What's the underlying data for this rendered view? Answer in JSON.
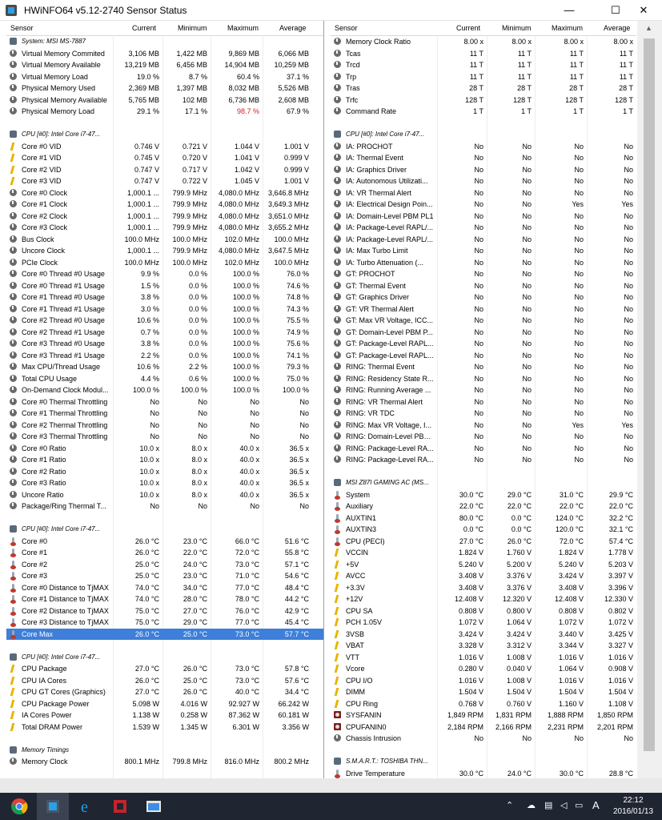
{
  "window": {
    "title": "HWiNFO64 v5.12-2740 Sensor Status",
    "minimize": "—",
    "maximize": "☐",
    "close": "✕"
  },
  "columns": {
    "sensor": "Sensor",
    "current": "Current",
    "minimum": "Minimum",
    "maximum": "Maximum",
    "average": "Average"
  },
  "left_rows": [
    {
      "type": "group",
      "name": "System: MSI MS-7887"
    },
    {
      "icon": "load",
      "name": "Virtual Memory Commited",
      "cur": "3,106 MB",
      "min": "1,422 MB",
      "max": "9,869 MB",
      "avg": "6,066 MB"
    },
    {
      "icon": "load",
      "name": "Virtual Memory Available",
      "cur": "13,219 MB",
      "min": "6,456 MB",
      "max": "14,904 MB",
      "avg": "10,259 MB"
    },
    {
      "icon": "load",
      "name": "Virtual Memory Load",
      "cur": "19.0 %",
      "min": "8.7 %",
      "max": "60.4 %",
      "avg": "37.1 %"
    },
    {
      "icon": "load",
      "name": "Physical Memory Used",
      "cur": "2,369 MB",
      "min": "1,397 MB",
      "max": "8,032 MB",
      "avg": "5,526 MB"
    },
    {
      "icon": "load",
      "name": "Physical Memory Available",
      "cur": "5,765 MB",
      "min": "102 MB",
      "max": "6,736 MB",
      "avg": "2,608 MB"
    },
    {
      "icon": "load",
      "name": "Physical Memory Load",
      "cur": "29.1 %",
      "min": "17.1 %",
      "max": "98.7 %",
      "avg": "67.9 %",
      "max_red": true
    },
    {
      "type": "spacer"
    },
    {
      "type": "group",
      "name": "CPU [#0]: Intel Core i7-47..."
    },
    {
      "icon": "volt",
      "name": "Core #0 VID",
      "cur": "0.746 V",
      "min": "0.721 V",
      "max": "1.044 V",
      "avg": "1.001 V"
    },
    {
      "icon": "volt",
      "name": "Core #1 VID",
      "cur": "0.745 V",
      "min": "0.720 V",
      "max": "1.041 V",
      "avg": "0.999 V"
    },
    {
      "icon": "volt",
      "name": "Core #2 VID",
      "cur": "0.747 V",
      "min": "0.717 V",
      "max": "1.042 V",
      "avg": "0.999 V"
    },
    {
      "icon": "volt",
      "name": "Core #3 VID",
      "cur": "0.747 V",
      "min": "0.722 V",
      "max": "1.045 V",
      "avg": "1.001 V"
    },
    {
      "icon": "load",
      "name": "Core #0 Clock",
      "cur": "1,000.1 ...",
      "min": "799.9 MHz",
      "max": "4,080.0 MHz",
      "avg": "3,646.8 MHz"
    },
    {
      "icon": "load",
      "name": "Core #1 Clock",
      "cur": "1,000.1 ...",
      "min": "799.9 MHz",
      "max": "4,080.0 MHz",
      "avg": "3,649.3 MHz"
    },
    {
      "icon": "load",
      "name": "Core #2 Clock",
      "cur": "1,000.1 ...",
      "min": "799.9 MHz",
      "max": "4,080.0 MHz",
      "avg": "3,651.0 MHz"
    },
    {
      "icon": "load",
      "name": "Core #3 Clock",
      "cur": "1,000.1 ...",
      "min": "799.9 MHz",
      "max": "4,080.0 MHz",
      "avg": "3,655.2 MHz"
    },
    {
      "icon": "load",
      "name": "Bus Clock",
      "cur": "100.0 MHz",
      "min": "100.0 MHz",
      "max": "102.0 MHz",
      "avg": "100.0 MHz"
    },
    {
      "icon": "load",
      "name": "Uncore Clock",
      "cur": "1,000.1 ...",
      "min": "799.9 MHz",
      "max": "4,080.0 MHz",
      "avg": "3,647.5 MHz"
    },
    {
      "icon": "load",
      "name": "PCIe Clock",
      "cur": "100.0 MHz",
      "min": "100.0 MHz",
      "max": "102.0 MHz",
      "avg": "100.0 MHz"
    },
    {
      "icon": "load",
      "name": "Core #0 Thread #0 Usage",
      "cur": "9.9 %",
      "min": "0.0 %",
      "max": "100.0 %",
      "avg": "76.0 %"
    },
    {
      "icon": "load",
      "name": "Core #0 Thread #1 Usage",
      "cur": "1.5 %",
      "min": "0.0 %",
      "max": "100.0 %",
      "avg": "74.6 %"
    },
    {
      "icon": "load",
      "name": "Core #1 Thread #0 Usage",
      "cur": "3.8 %",
      "min": "0.0 %",
      "max": "100.0 %",
      "avg": "74.8 %"
    },
    {
      "icon": "load",
      "name": "Core #1 Thread #1 Usage",
      "cur": "3.0 %",
      "min": "0.0 %",
      "max": "100.0 %",
      "avg": "74.3 %"
    },
    {
      "icon": "load",
      "name": "Core #2 Thread #0 Usage",
      "cur": "10.6 %",
      "min": "0.0 %",
      "max": "100.0 %",
      "avg": "75.5 %"
    },
    {
      "icon": "load",
      "name": "Core #2 Thread #1 Usage",
      "cur": "0.7 %",
      "min": "0.0 %",
      "max": "100.0 %",
      "avg": "74.9 %"
    },
    {
      "icon": "load",
      "name": "Core #3 Thread #0 Usage",
      "cur": "3.8 %",
      "min": "0.0 %",
      "max": "100.0 %",
      "avg": "75.6 %"
    },
    {
      "icon": "load",
      "name": "Core #3 Thread #1 Usage",
      "cur": "2.2 %",
      "min": "0.0 %",
      "max": "100.0 %",
      "avg": "74.1 %"
    },
    {
      "icon": "load",
      "name": "Max CPU/Thread Usage",
      "cur": "10.6 %",
      "min": "2.2 %",
      "max": "100.0 %",
      "avg": "79.3 %"
    },
    {
      "icon": "load",
      "name": "Total CPU Usage",
      "cur": "4.4 %",
      "min": "0.6 %",
      "max": "100.0 %",
      "avg": "75.0 %"
    },
    {
      "icon": "load",
      "name": "On-Demand Clock Modul...",
      "cur": "100.0 %",
      "min": "100.0 %",
      "max": "100.0 %",
      "avg": "100.0 %"
    },
    {
      "icon": "load",
      "name": "Core #0 Thermal Throttling",
      "cur": "No",
      "min": "No",
      "max": "No",
      "avg": "No"
    },
    {
      "icon": "load",
      "name": "Core #1 Thermal Throttling",
      "cur": "No",
      "min": "No",
      "max": "No",
      "avg": "No"
    },
    {
      "icon": "load",
      "name": "Core #2 Thermal Throttling",
      "cur": "No",
      "min": "No",
      "max": "No",
      "avg": "No"
    },
    {
      "icon": "load",
      "name": "Core #3 Thermal Throttling",
      "cur": "No",
      "min": "No",
      "max": "No",
      "avg": "No"
    },
    {
      "icon": "load",
      "name": "Core #0 Ratio",
      "cur": "10.0 x",
      "min": "8.0 x",
      "max": "40.0 x",
      "avg": "36.5 x"
    },
    {
      "icon": "load",
      "name": "Core #1 Ratio",
      "cur": "10.0 x",
      "min": "8.0 x",
      "max": "40.0 x",
      "avg": "36.5 x"
    },
    {
      "icon": "load",
      "name": "Core #2 Ratio",
      "cur": "10.0 x",
      "min": "8.0 x",
      "max": "40.0 x",
      "avg": "36.5 x"
    },
    {
      "icon": "load",
      "name": "Core #3 Ratio",
      "cur": "10.0 x",
      "min": "8.0 x",
      "max": "40.0 x",
      "avg": "36.5 x"
    },
    {
      "icon": "load",
      "name": "Uncore Ratio",
      "cur": "10.0 x",
      "min": "8.0 x",
      "max": "40.0 x",
      "avg": "36.5 x"
    },
    {
      "icon": "load",
      "name": "Package/Ring Thermal T...",
      "cur": "No",
      "min": "No",
      "max": "No",
      "avg": "No"
    },
    {
      "type": "spacer"
    },
    {
      "type": "group",
      "name": "CPU [#0]: Intel Core i7-47..."
    },
    {
      "icon": "temp",
      "name": "Core #0",
      "cur": "26.0 °C",
      "min": "23.0 °C",
      "max": "66.0 °C",
      "avg": "51.6 °C"
    },
    {
      "icon": "temp",
      "name": "Core #1",
      "cur": "26.0 °C",
      "min": "22.0 °C",
      "max": "72.0 °C",
      "avg": "55.8 °C"
    },
    {
      "icon": "temp",
      "name": "Core #2",
      "cur": "25.0 °C",
      "min": "24.0 °C",
      "max": "73.0 °C",
      "avg": "57.1 °C"
    },
    {
      "icon": "temp",
      "name": "Core #3",
      "cur": "25.0 °C",
      "min": "23.0 °C",
      "max": "71.0 °C",
      "avg": "54.6 °C"
    },
    {
      "icon": "temp",
      "name": "Core #0 Distance to TjMAX",
      "cur": "74.0 °C",
      "min": "34.0 °C",
      "max": "77.0 °C",
      "avg": "48.4 °C"
    },
    {
      "icon": "temp",
      "name": "Core #1 Distance to TjMAX",
      "cur": "74.0 °C",
      "min": "28.0 °C",
      "max": "78.0 °C",
      "avg": "44.2 °C"
    },
    {
      "icon": "temp",
      "name": "Core #2 Distance to TjMAX",
      "cur": "75.0 °C",
      "min": "27.0 °C",
      "max": "76.0 °C",
      "avg": "42.9 °C"
    },
    {
      "icon": "temp",
      "name": "Core #3 Distance to TjMAX",
      "cur": "75.0 °C",
      "min": "29.0 °C",
      "max": "77.0 °C",
      "avg": "45.4 °C"
    },
    {
      "icon": "temp",
      "name": "Core Max",
      "cur": "26.0 °C",
      "min": "25.0 °C",
      "max": "73.0 °C",
      "avg": "57.7 °C",
      "selected": true
    },
    {
      "type": "spacer"
    },
    {
      "type": "group",
      "name": "CPU [#0]: Intel Core i7-47..."
    },
    {
      "icon": "volt",
      "name": "CPU Package",
      "cur": "27.0 °C",
      "min": "26.0 °C",
      "max": "73.0 °C",
      "avg": "57.8 °C"
    },
    {
      "icon": "volt",
      "name": "CPU IA Cores",
      "cur": "26.0 °C",
      "min": "25.0 °C",
      "max": "73.0 °C",
      "avg": "57.6 °C"
    },
    {
      "icon": "volt",
      "name": "CPU GT Cores (Graphics)",
      "cur": "27.0 °C",
      "min": "26.0 °C",
      "max": "40.0 °C",
      "avg": "34.4 °C"
    },
    {
      "icon": "volt",
      "name": "CPU Package Power",
      "cur": "5.098 W",
      "min": "4.016 W",
      "max": "92.927 W",
      "avg": "66.242 W"
    },
    {
      "icon": "volt",
      "name": "IA Cores Power",
      "cur": "1.138 W",
      "min": "0.258 W",
      "max": "87.362 W",
      "avg": "60.181 W"
    },
    {
      "icon": "volt",
      "name": "Total DRAM Power",
      "cur": "1.539 W",
      "min": "1.345 W",
      "max": "6.301 W",
      "avg": "3.356 W"
    },
    {
      "type": "spacer"
    },
    {
      "type": "group",
      "name": "Memory Timings"
    },
    {
      "icon": "load",
      "name": "Memory Clock",
      "cur": "800.1 MHz",
      "min": "799.8 MHz",
      "max": "816.0 MHz",
      "avg": "800.2 MHz"
    }
  ],
  "right_rows": [
    {
      "icon": "load",
      "name": "Memory Clock Ratio",
      "cur": "8.00 x",
      "min": "8.00 x",
      "max": "8.00 x",
      "avg": "8.00 x"
    },
    {
      "icon": "load",
      "name": "Tcas",
      "cur": "11 T",
      "min": "11 T",
      "max": "11 T",
      "avg": "11 T"
    },
    {
      "icon": "load",
      "name": "Trcd",
      "cur": "11 T",
      "min": "11 T",
      "max": "11 T",
      "avg": "11 T"
    },
    {
      "icon": "load",
      "name": "Trp",
      "cur": "11 T",
      "min": "11 T",
      "max": "11 T",
      "avg": "11 T"
    },
    {
      "icon": "load",
      "name": "Tras",
      "cur": "28 T",
      "min": "28 T",
      "max": "28 T",
      "avg": "28 T"
    },
    {
      "icon": "load",
      "name": "Trfc",
      "cur": "128 T",
      "min": "128 T",
      "max": "128 T",
      "avg": "128 T"
    },
    {
      "icon": "load",
      "name": "Command Rate",
      "cur": "1 T",
      "min": "1 T",
      "max": "1 T",
      "avg": "1 T"
    },
    {
      "type": "spacer"
    },
    {
      "type": "group",
      "name": "CPU [#0]: Intel Core i7-47..."
    },
    {
      "icon": "load",
      "name": "IA: PROCHOT",
      "cur": "No",
      "min": "No",
      "max": "No",
      "avg": "No"
    },
    {
      "icon": "load",
      "name": "IA: Thermal Event",
      "cur": "No",
      "min": "No",
      "max": "No",
      "avg": "No"
    },
    {
      "icon": "load",
      "name": "IA: Graphics Driver",
      "cur": "No",
      "min": "No",
      "max": "No",
      "avg": "No"
    },
    {
      "icon": "load",
      "name": "IA: Autonomous Utilizati...",
      "cur": "No",
      "min": "No",
      "max": "No",
      "avg": "No"
    },
    {
      "icon": "load",
      "name": "IA: VR Thermal Alert",
      "cur": "No",
      "min": "No",
      "max": "No",
      "avg": "No"
    },
    {
      "icon": "load",
      "name": "IA: Electrical Design Poin...",
      "cur": "No",
      "min": "No",
      "max": "Yes",
      "avg": "Yes"
    },
    {
      "icon": "load",
      "name": "IA: Domain-Level PBM PL1",
      "cur": "No",
      "min": "No",
      "max": "No",
      "avg": "No"
    },
    {
      "icon": "load",
      "name": "IA: Package-Level RAPL/...",
      "cur": "No",
      "min": "No",
      "max": "No",
      "avg": "No"
    },
    {
      "icon": "load",
      "name": "IA: Package-Level RAPL/...",
      "cur": "No",
      "min": "No",
      "max": "No",
      "avg": "No"
    },
    {
      "icon": "load",
      "name": "IA: Max Turbo Limit",
      "cur": "No",
      "min": "No",
      "max": "No",
      "avg": "No"
    },
    {
      "icon": "load",
      "name": "IA: Turbo Attenuation (...",
      "cur": "No",
      "min": "No",
      "max": "No",
      "avg": "No"
    },
    {
      "icon": "load",
      "name": "GT: PROCHOT",
      "cur": "No",
      "min": "No",
      "max": "No",
      "avg": "No"
    },
    {
      "icon": "load",
      "name": "GT: Thermal Event",
      "cur": "No",
      "min": "No",
      "max": "No",
      "avg": "No"
    },
    {
      "icon": "load",
      "name": "GT: Graphics Driver",
      "cur": "No",
      "min": "No",
      "max": "No",
      "avg": "No"
    },
    {
      "icon": "load",
      "name": "GT: VR Thermal Alert",
      "cur": "No",
      "min": "No",
      "max": "No",
      "avg": "No"
    },
    {
      "icon": "load",
      "name": "GT: Max VR Voltage, ICC...",
      "cur": "No",
      "min": "No",
      "max": "No",
      "avg": "No"
    },
    {
      "icon": "load",
      "name": "GT: Domain-Level PBM P...",
      "cur": "No",
      "min": "No",
      "max": "No",
      "avg": "No"
    },
    {
      "icon": "load",
      "name": "GT: Package-Level RAPL...",
      "cur": "No",
      "min": "No",
      "max": "No",
      "avg": "No"
    },
    {
      "icon": "load",
      "name": "GT: Package-Level RAPL...",
      "cur": "No",
      "min": "No",
      "max": "No",
      "avg": "No"
    },
    {
      "icon": "load",
      "name": "RING: Thermal Event",
      "cur": "No",
      "min": "No",
      "max": "No",
      "avg": "No"
    },
    {
      "icon": "load",
      "name": "RING: Residency State R...",
      "cur": "No",
      "min": "No",
      "max": "No",
      "avg": "No"
    },
    {
      "icon": "load",
      "name": "RING: Running Average ...",
      "cur": "No",
      "min": "No",
      "max": "No",
      "avg": "No"
    },
    {
      "icon": "load",
      "name": "RING: VR Thermal Alert",
      "cur": "No",
      "min": "No",
      "max": "No",
      "avg": "No"
    },
    {
      "icon": "load",
      "name": "RING: VR TDC",
      "cur": "No",
      "min": "No",
      "max": "No",
      "avg": "No"
    },
    {
      "icon": "load",
      "name": "RING: Max VR Voltage, I...",
      "cur": "No",
      "min": "No",
      "max": "Yes",
      "avg": "Yes"
    },
    {
      "icon": "load",
      "name": "RING: Domain-Level PBM...",
      "cur": "No",
      "min": "No",
      "max": "No",
      "avg": "No"
    },
    {
      "icon": "load",
      "name": "RING: Package-Level RA...",
      "cur": "No",
      "min": "No",
      "max": "No",
      "avg": "No"
    },
    {
      "icon": "load",
      "name": "RING: Package-Level RA...",
      "cur": "No",
      "min": "No",
      "max": "No",
      "avg": "No"
    },
    {
      "type": "spacer"
    },
    {
      "type": "group",
      "name": "MSI Z87I GAMING AC (MS..."
    },
    {
      "icon": "temp",
      "name": "System",
      "cur": "30.0 °C",
      "min": "29.0 °C",
      "max": "31.0 °C",
      "avg": "29.9 °C"
    },
    {
      "icon": "temp",
      "name": "Auxiliary",
      "cur": "22.0 °C",
      "min": "22.0 °C",
      "max": "22.0 °C",
      "avg": "22.0 °C"
    },
    {
      "icon": "temp",
      "name": "AUXTIN1",
      "cur": "80.0 °C",
      "min": "0.0 °C",
      "max": "124.0 °C",
      "avg": "32.2 °C"
    },
    {
      "icon": "temp",
      "name": "AUXTIN3",
      "cur": "0.0 °C",
      "min": "0.0 °C",
      "max": "120.0 °C",
      "avg": "32.1 °C"
    },
    {
      "icon": "temp",
      "name": "CPU (PECI)",
      "cur": "27.0 °C",
      "min": "26.0 °C",
      "max": "72.0 °C",
      "avg": "57.4 °C"
    },
    {
      "icon": "volt",
      "name": "VCCIN",
      "cur": "1.824 V",
      "min": "1.760 V",
      "max": "1.824 V",
      "avg": "1.778 V"
    },
    {
      "icon": "volt",
      "name": "+5V",
      "cur": "5.240 V",
      "min": "5.200 V",
      "max": "5.240 V",
      "avg": "5.203 V"
    },
    {
      "icon": "volt",
      "name": "AVCC",
      "cur": "3.408 V",
      "min": "3.376 V",
      "max": "3.424 V",
      "avg": "3.397 V"
    },
    {
      "icon": "volt",
      "name": "+3.3V",
      "cur": "3.408 V",
      "min": "3.376 V",
      "max": "3.408 V",
      "avg": "3.396 V"
    },
    {
      "icon": "volt",
      "name": "+12V",
      "cur": "12.408 V",
      "min": "12.320 V",
      "max": "12.408 V",
      "avg": "12.330 V"
    },
    {
      "icon": "volt",
      "name": "CPU SA",
      "cur": "0.808 V",
      "min": "0.800 V",
      "max": "0.808 V",
      "avg": "0.802 V"
    },
    {
      "icon": "volt",
      "name": "PCH 1.05V",
      "cur": "1.072 V",
      "min": "1.064 V",
      "max": "1.072 V",
      "avg": "1.072 V"
    },
    {
      "icon": "volt",
      "name": "3VSB",
      "cur": "3.424 V",
      "min": "3.424 V",
      "max": "3.440 V",
      "avg": "3.425 V"
    },
    {
      "icon": "volt",
      "name": "VBAT",
      "cur": "3.328 V",
      "min": "3.312 V",
      "max": "3.344 V",
      "avg": "3.327 V"
    },
    {
      "icon": "volt",
      "name": "VTT",
      "cur": "1.016 V",
      "min": "1.008 V",
      "max": "1.016 V",
      "avg": "1.016 V"
    },
    {
      "icon": "volt",
      "name": "Vcore",
      "cur": "0.280 V",
      "min": "0.040 V",
      "max": "1.064 V",
      "avg": "0.908 V"
    },
    {
      "icon": "volt",
      "name": "CPU I/O",
      "cur": "1.016 V",
      "min": "1.008 V",
      "max": "1.016 V",
      "avg": "1.016 V"
    },
    {
      "icon": "volt",
      "name": "DIMM",
      "cur": "1.504 V",
      "min": "1.504 V",
      "max": "1.504 V",
      "avg": "1.504 V"
    },
    {
      "icon": "volt",
      "name": "CPU Ring",
      "cur": "0.768 V",
      "min": "0.760 V",
      "max": "1.160 V",
      "avg": "1.108 V"
    },
    {
      "icon": "fan",
      "name": "SYSFANIN",
      "cur": "1,849 RPM",
      "min": "1,831 RPM",
      "max": "1,888 RPM",
      "avg": "1,850 RPM"
    },
    {
      "icon": "fan",
      "name": "CPUFANIN0",
      "cur": "2,184 RPM",
      "min": "2,166 RPM",
      "max": "2,231 RPM",
      "avg": "2,201 RPM"
    },
    {
      "icon": "load",
      "name": "Chassis Intrusion",
      "cur": "No",
      "min": "No",
      "max": "No",
      "avg": "No"
    },
    {
      "type": "spacer"
    },
    {
      "type": "group",
      "name": "S.M.A.R.T.: TOSHIBA THN..."
    },
    {
      "icon": "temp",
      "name": "Drive Temperature",
      "cur": "30.0 °C",
      "min": "24.0 °C",
      "max": "30.0 °C",
      "avg": "28.8 °C"
    }
  ],
  "colors": {
    "selected": "#3d7fd9",
    "alert": "#d21f1f",
    "taskbar": "#1f2531"
  },
  "taskbar": {
    "apps": [
      "chrome-icon",
      "hwinfo-icon",
      "ie-icon",
      "amd-icon",
      "explorer-icon"
    ],
    "tray_lang": "A",
    "clock_time": "22:12",
    "clock_date": "2016/01/13"
  }
}
